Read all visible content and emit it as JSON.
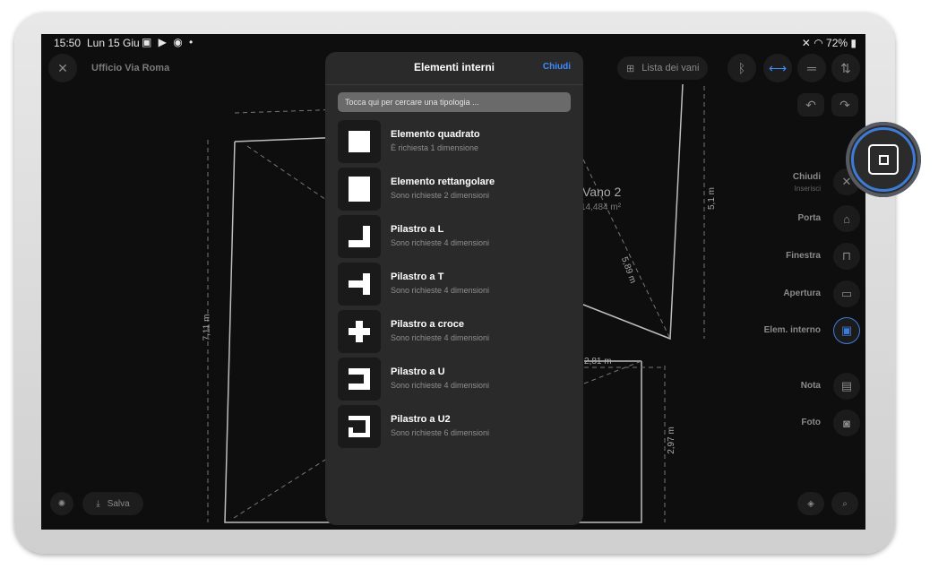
{
  "status": {
    "time": "15:50",
    "date": "Lun 15 Giu",
    "battery": "72%"
  },
  "header": {
    "title": "Ufficio Via Roma",
    "rooms_list_label": "Lista dei vani"
  },
  "floorplan": {
    "room_name": "Vano 2",
    "room_area": "14,484 m²",
    "measurements": [
      "5,1 m",
      "5,89 m",
      "7,11 m",
      "2,81 m",
      "2,97 m"
    ]
  },
  "modal": {
    "title": "Elementi interni",
    "close_label": "Chiudi",
    "search_placeholder": "Tocca qui per cercare una tipologia ...",
    "items": [
      {
        "name": "Elemento quadrato",
        "desc": "È richiesta 1 dimensione",
        "icon": "square-element-icon"
      },
      {
        "name": "Elemento rettangolare",
        "desc": "Sono richieste 2 dimensioni",
        "icon": "rectangle-element-icon"
      },
      {
        "name": "Pilastro a L",
        "desc": "Sono richieste 4 dimensioni",
        "icon": "l-pillar-icon"
      },
      {
        "name": "Pilastro a T",
        "desc": "Sono richieste 4 dimensioni",
        "icon": "t-pillar-icon"
      },
      {
        "name": "Pilastro a croce",
        "desc": "Sono richieste 4 dimensioni",
        "icon": "cross-pillar-icon"
      },
      {
        "name": "Pilastro a U",
        "desc": "Sono richieste 4 dimensioni",
        "icon": "u-pillar-icon"
      },
      {
        "name": "Pilastro a U2",
        "desc": "Sono richieste 6 dimensioni",
        "icon": "u2-pillar-icon"
      }
    ]
  },
  "side_menu": {
    "close_label": "Chiudi",
    "close_sub": "Inserisci",
    "items": [
      "Porta",
      "Finestra",
      "Apertura",
      "Elem. interno",
      "Nota",
      "Foto"
    ]
  },
  "bottom": {
    "save_label": "Salva"
  },
  "colors": {
    "accent": "#3d8bff",
    "highlight_ring": "#3e7bd7",
    "modal_bg": "#2a2a2a",
    "screen_bg": "#0e0e0e"
  }
}
